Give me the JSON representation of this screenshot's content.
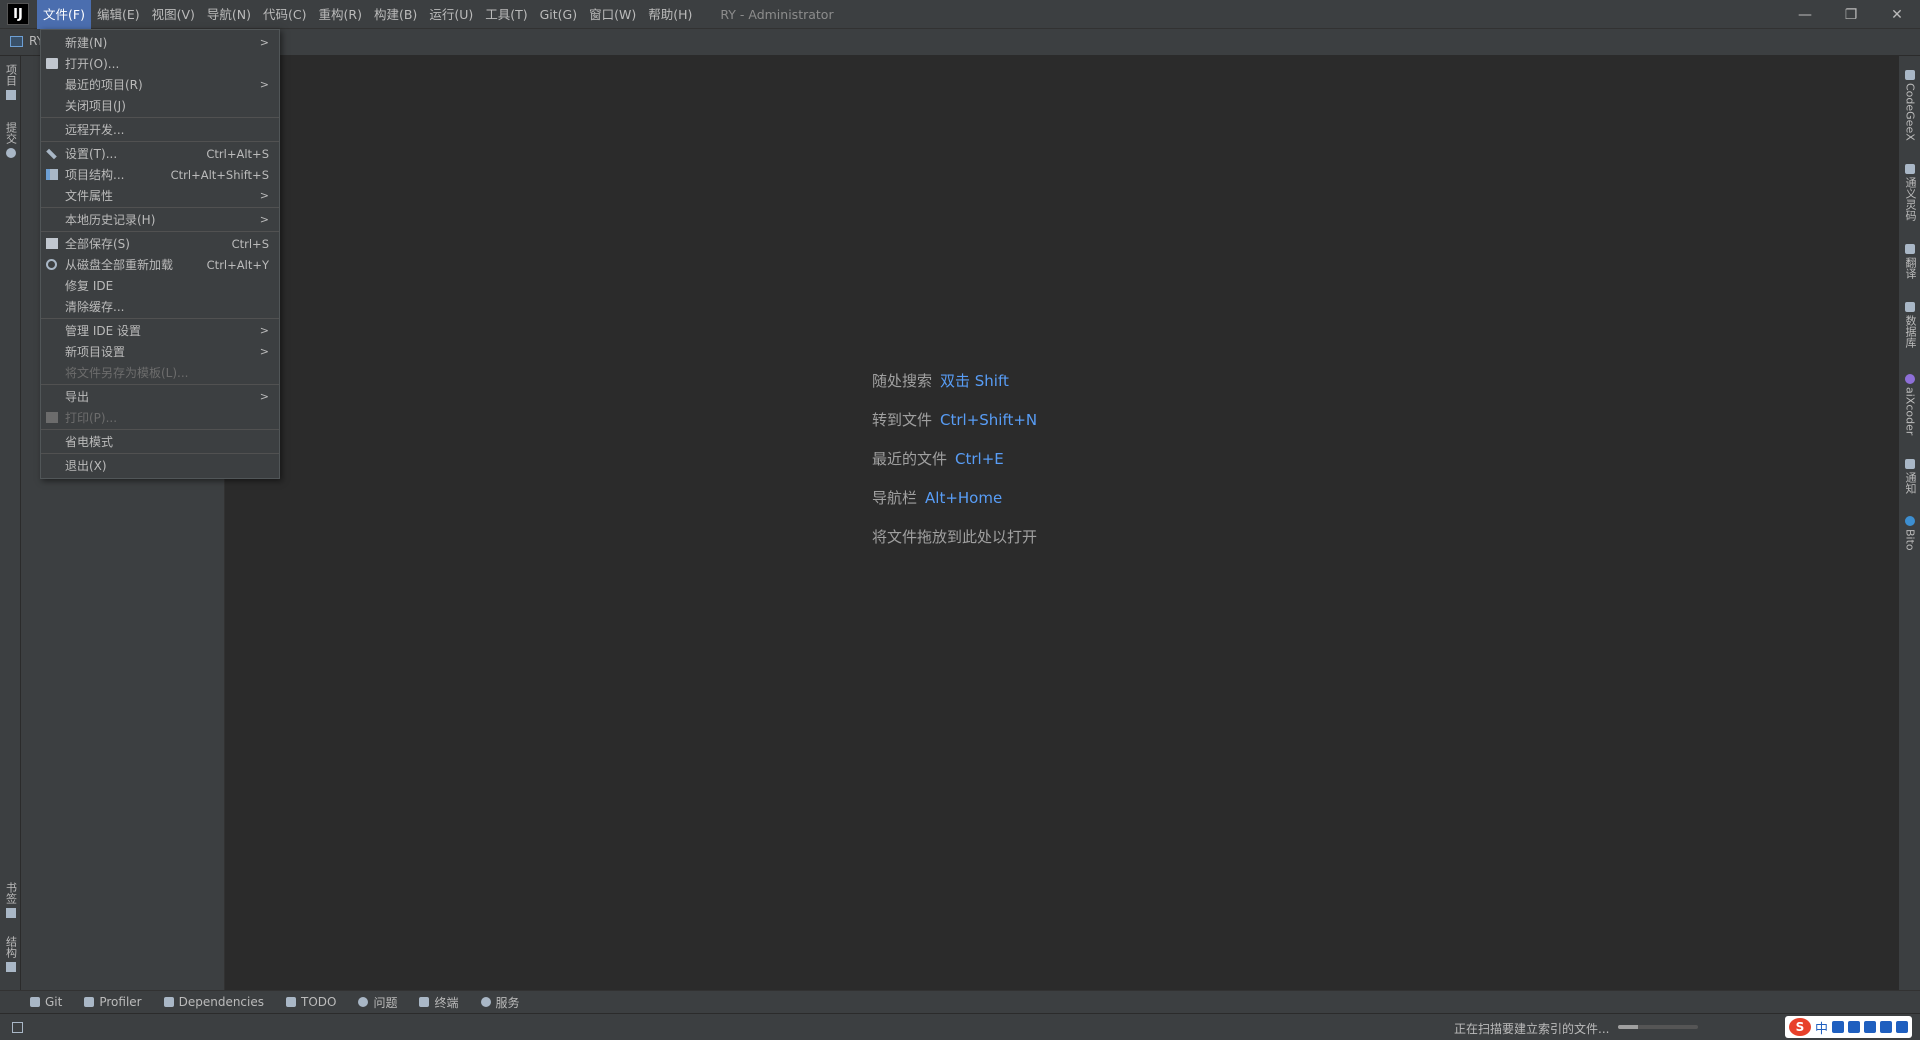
{
  "titlebar": {
    "logo_text": "IJ",
    "menus": [
      "文件(F)",
      "编辑(E)",
      "视图(V)",
      "导航(N)",
      "代码(C)",
      "重构(R)",
      "构建(B)",
      "运行(U)",
      "工具(T)",
      "Git(G)",
      "窗口(W)",
      "帮助(H)"
    ],
    "window_title": "RY - Administrator",
    "controls": {
      "minimize": "—",
      "restore": "❐",
      "close": "✕"
    }
  },
  "navbar": {
    "project_name": "RY"
  },
  "left_stripe": {
    "tabs": [
      {
        "label": "项目",
        "icon": "folder-icon"
      },
      {
        "label": "提交",
        "icon": "commit-icon"
      },
      {
        "label": "书签",
        "icon": "bookmark-icon"
      },
      {
        "label": "结构",
        "icon": "structure-icon"
      }
    ]
  },
  "right_stripe": {
    "tabs": [
      {
        "label": "CodeGeeX",
        "icon": "codegeex-icon"
      },
      {
        "label": "通义灵码",
        "icon": "tongyi-icon"
      },
      {
        "label": "翻译",
        "icon": "translate-icon"
      },
      {
        "label": "数据库",
        "icon": "database-icon"
      },
      {
        "label": "aiXcoder",
        "icon": "aixcoder-icon"
      },
      {
        "label": "通知",
        "icon": "bell-icon"
      },
      {
        "label": "Bito",
        "icon": "bito-icon"
      }
    ]
  },
  "file_menu": {
    "items": [
      {
        "label": "新建(N)",
        "submenu": true
      },
      {
        "label": "打开(O)...",
        "icon": "folder-open-icon"
      },
      {
        "label": "最近的项目(R)",
        "submenu": true
      },
      {
        "label": "关闭项目(J)"
      },
      {
        "label": "远程开发..."
      },
      {
        "label": "设置(T)...",
        "shortcut": "Ctrl+Alt+S",
        "icon": "wrench-icon"
      },
      {
        "label": "项目结构...",
        "shortcut": "Ctrl+Alt+Shift+S",
        "icon": "project-structure-icon"
      },
      {
        "label": "文件属性",
        "submenu": true
      },
      {
        "label": "本地历史记录(H)",
        "submenu": true
      },
      {
        "label": "全部保存(S)",
        "shortcut": "Ctrl+S",
        "icon": "save-icon"
      },
      {
        "label": "从磁盘全部重新加载",
        "shortcut": "Ctrl+Alt+Y",
        "icon": "reload-icon"
      },
      {
        "label": "修复 IDE"
      },
      {
        "label": "清除缓存..."
      },
      {
        "label": "管理 IDE 设置",
        "submenu": true
      },
      {
        "label": "新项目设置",
        "submenu": true
      },
      {
        "label": "将文件另存为模板(L)...",
        "disabled": true
      },
      {
        "label": "导出",
        "submenu": true
      },
      {
        "label": "打印(P)...",
        "disabled": true,
        "icon": "print-icon"
      },
      {
        "label": "省电模式"
      },
      {
        "label": "退出(X)"
      }
    ]
  },
  "welcome": {
    "hints": [
      {
        "label": "随处搜索",
        "key": "双击 Shift"
      },
      {
        "label": "转到文件",
        "key": "Ctrl+Shift+N"
      },
      {
        "label": "最近的文件",
        "key": "Ctrl+E"
      },
      {
        "label": "导航栏",
        "key": "Alt+Home"
      },
      {
        "label": "将文件拖放到此处以打开",
        "key": ""
      }
    ]
  },
  "bottom_toolbar": {
    "tabs": [
      {
        "label": "Git",
        "icon": "git-icon"
      },
      {
        "label": "Profiler",
        "icon": "profiler-icon"
      },
      {
        "label": "Dependencies",
        "icon": "dependencies-icon"
      },
      {
        "label": "TODO",
        "icon": "todo-icon"
      },
      {
        "label": "问题",
        "icon": "problems-icon"
      },
      {
        "label": "终端",
        "icon": "terminal-icon"
      },
      {
        "label": "服务",
        "icon": "services-icon"
      }
    ]
  },
  "statusbar": {
    "indexing_text": "正在扫描要建立索引的文件...",
    "progress_fraction": 0.25,
    "ime": {
      "logo": "S",
      "mode": "中"
    }
  },
  "colors": {
    "accent": "#4b6eaf",
    "link": "#589df6",
    "background": "#2b2b2b",
    "panel": "#3c3f41"
  }
}
